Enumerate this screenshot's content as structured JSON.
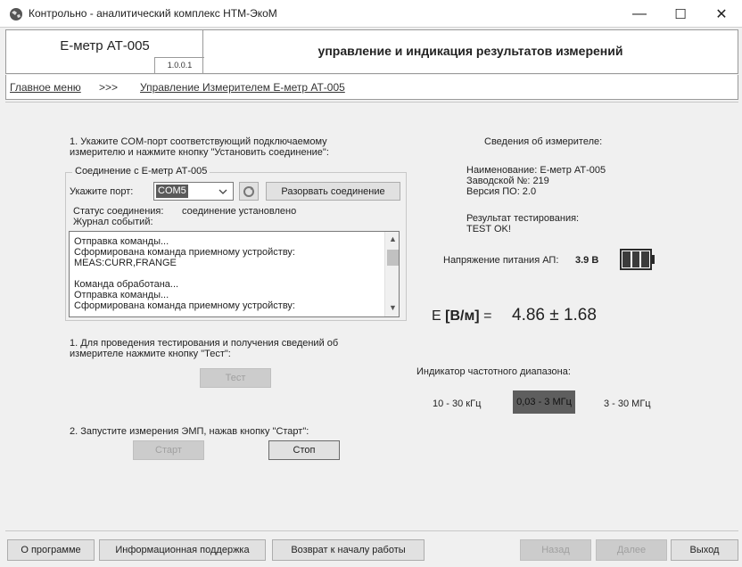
{
  "window": {
    "title": "Контрольно - аналитический комплекс НТМ-ЭкоМ",
    "minimize": "—",
    "maximize": "☐",
    "close": "✕"
  },
  "header": {
    "device_name": "E-метр АТ-005",
    "version": "1.0.0.1",
    "title": "управление и индикация результатов измерений"
  },
  "breadcrumb": {
    "home": "Главное меню",
    "separator": ">>>",
    "current": "Управление Измерителем E-метр АТ-005"
  },
  "connection": {
    "instruction": "1. Укажите COM-порт соответствующий подключаемому\nизмерителю и нажмите кнопку \"Установить соединение\":",
    "group_title": "Соединение с E-метр АТ-005",
    "port_label": "Укажите порт:",
    "port_value": "COM5",
    "disconnect_button": "Разорвать соединение",
    "status_label": "Статус соединения:",
    "status_value": "соединение установлено",
    "log_label": "Журнал событий:",
    "log_text": "Отправка команды...\nСформирована команда приемному устройству:\nMEAS:CURR,FRANGE\n\nКоманда обработана...\nОтправка команды...\nСформирована команда приемному устройству:"
  },
  "test": {
    "instruction": "1. Для проведения тестирования и получения сведений об\nизмерителе нажмите кнопку \"Тест\":",
    "button": "Тест"
  },
  "measure": {
    "instruction": "2. Запустите измерения ЭМП, нажав кнопку \"Старт\":",
    "start_button": "Старт",
    "stop_button": "Стоп"
  },
  "device_info": {
    "title": "Сведения об измерителе:",
    "name": "Наименование: E-метр АТ-005",
    "serial": "Заводской №: 219",
    "firmware": "Версия ПО: 2.0",
    "test_result_label": "Результат тестирования:",
    "test_result_value": "TEST OK!"
  },
  "power": {
    "label": "Напряжение питания АП:",
    "value": "3.9 В",
    "battery_segments_filled": 3,
    "battery_segments_total": 3
  },
  "reading": {
    "label_prefix": "E ",
    "label_unit": "[В/м]",
    "label_suffix": " =",
    "value": "4.86 ± 1.68"
  },
  "frequency": {
    "label": "Индикатор частотного диапазона:",
    "ranges": [
      "10 - 30 кГц",
      "0,03 - 3 МГц",
      "3 - 30 МГц"
    ],
    "active_index": 1
  },
  "footer": {
    "about": "О программе",
    "support": "Информационная поддержка",
    "restart": "Возврат к началу работы",
    "back": "Назад",
    "next": "Далее",
    "exit": "Выход"
  },
  "colors": {
    "background": "#f0f0f0",
    "active_range": "#5e5e5e",
    "disabled_text": "#a0a0a0"
  }
}
